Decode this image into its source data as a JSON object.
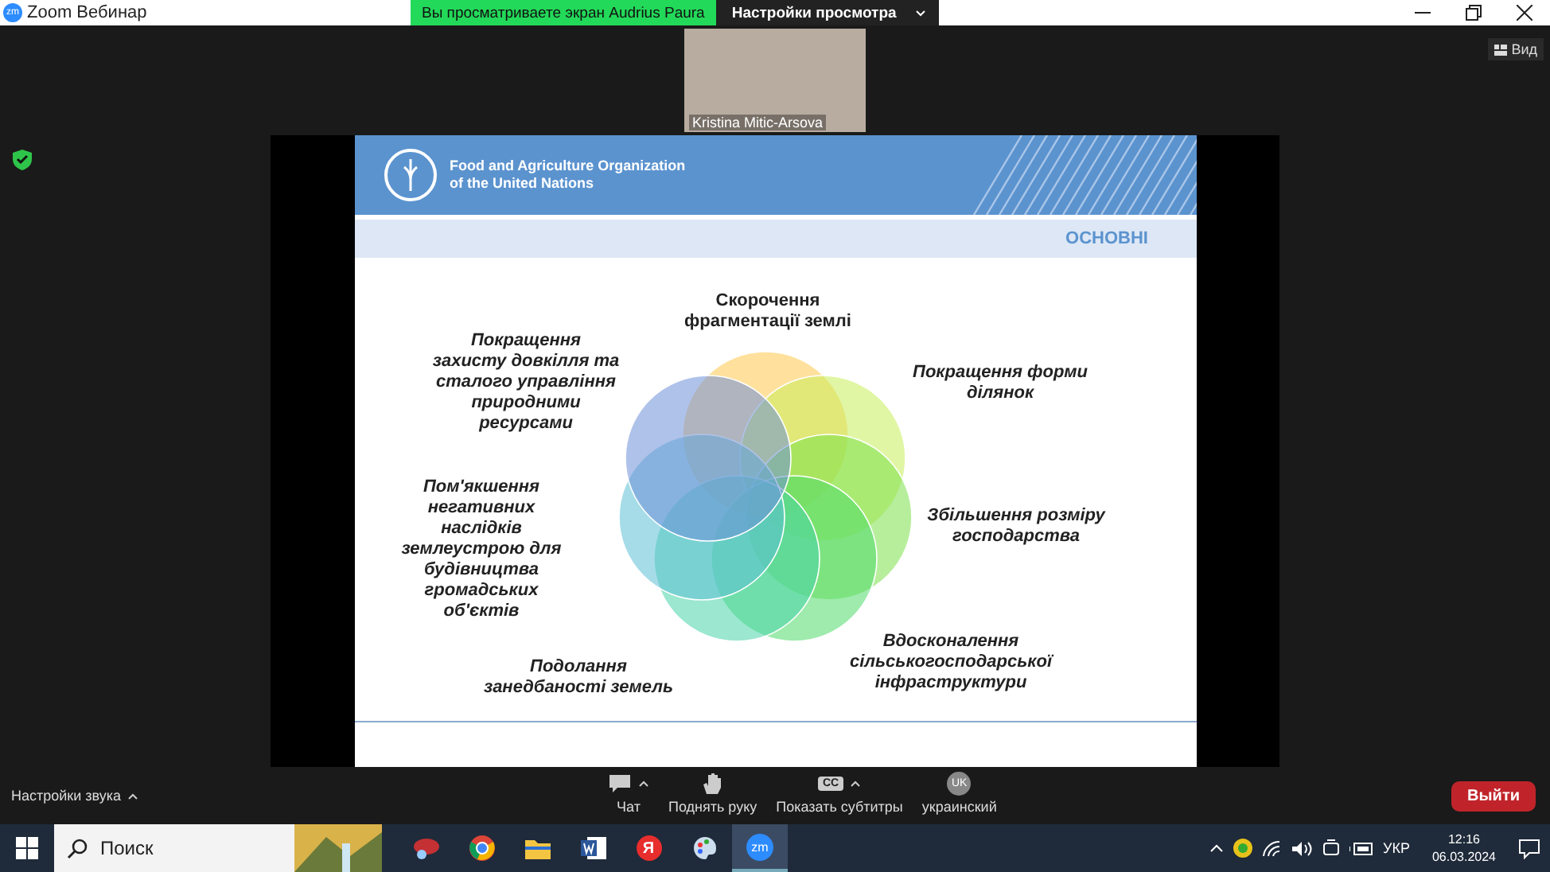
{
  "window": {
    "title": "Zoom Вебинар",
    "logo_text": "zm"
  },
  "share_banner": {
    "text": "Вы просматриваете экран Audrius Paura"
  },
  "view_options": {
    "label": "Настройки просмотра"
  },
  "view_button": {
    "label": "Вид"
  },
  "video": {
    "name": "Kristina Mitic-Arsova"
  },
  "slide": {
    "org_lines": [
      "Food and Agriculture Organization",
      "of the United Nations"
    ],
    "section": "ОСНОВНІ",
    "labels": [
      {
        "lines": [
          "Скорочення",
          "фрагментації землі"
        ],
        "italic": false
      },
      {
        "lines": [
          "Покращення",
          "захисту довкілля та",
          "сталого управління",
          "природними",
          "ресурсами"
        ],
        "italic": true
      },
      {
        "lines": [
          "Покращення форми",
          "ділянок"
        ],
        "italic": true
      },
      {
        "lines": [
          "Пом'якшення",
          "негативних",
          "наслідків",
          "землеустрою для",
          "будівництва",
          "громадських",
          "об'єктів"
        ],
        "italic": true
      },
      {
        "lines": [
          "Збільшення розміру",
          "господарства"
        ],
        "italic": true
      },
      {
        "lines": [
          "Подолання",
          "занедбаності земель"
        ],
        "italic": true
      },
      {
        "lines": [
          "Вдосконалення",
          "сільськогосподарської",
          "інфраструктури"
        ],
        "italic": true
      }
    ]
  },
  "toolbar": {
    "audio_settings": "Настройки звука",
    "buttons": [
      {
        "kind": "chat",
        "label": "Чат",
        "caret": true
      },
      {
        "kind": "hand",
        "label": "Поднять руку",
        "caret": false
      },
      {
        "kind": "cc",
        "label": "Показать субтитры",
        "caret": true,
        "icon_text": "CC"
      },
      {
        "kind": "lang",
        "label": "украинский",
        "caret": false,
        "icon_text": "UK"
      }
    ],
    "leave": "Выйти"
  },
  "taskbar": {
    "search_placeholder": "Поиск",
    "apps": [
      {
        "kind": "snip",
        "selected": false
      },
      {
        "kind": "chrome",
        "selected": false
      },
      {
        "kind": "folder",
        "selected": false
      },
      {
        "kind": "word",
        "selected": false
      },
      {
        "kind": "yandex",
        "selected": false,
        "icon_text": "Я"
      },
      {
        "kind": "paint",
        "selected": false
      },
      {
        "kind": "zoom",
        "selected": true,
        "icon_text": "zm"
      }
    ],
    "language": "УКР",
    "time": "12:16",
    "date": "06.03.2024"
  }
}
